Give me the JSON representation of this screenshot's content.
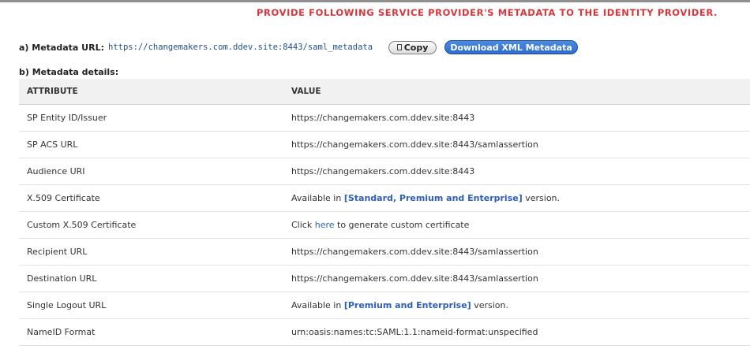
{
  "notice": "PROVIDE FOLLOWING SERVICE PROVIDER'S METADATA TO THE IDENTITY PROVIDER.",
  "metadata_url": {
    "label": "a) Metadata URL:",
    "value": "https://changemakers.com.ddev.site:8443/saml_metadata",
    "copy_label": "Copy",
    "copy_icon": "copy-icon",
    "download_label": "Download XML Metadata"
  },
  "details": {
    "title": "b) Metadata details:",
    "headers": {
      "attribute": "ATTRIBUTE",
      "value": "VALUE"
    },
    "rows": [
      {
        "attribute": "SP Entity ID/Issuer",
        "value": "https://changemakers.com.ddev.site:8443"
      },
      {
        "attribute": "SP ACS URL",
        "value": "https://changemakers.com.ddev.site:8443/samlassertion"
      },
      {
        "attribute": "Audience URI",
        "value": "https://changemakers.com.ddev.site:8443"
      },
      {
        "attribute": "X.509 Certificate",
        "prefix": "Available in ",
        "highlight": "[Standard, Premium and Enterprise]",
        "suffix": " version."
      },
      {
        "attribute": "Custom X.509 Certificate",
        "prefix": "Click ",
        "link": "here",
        "suffix": " to generate custom certificate"
      },
      {
        "attribute": "Recipient URL",
        "value": "https://changemakers.com.ddev.site:8443/samlassertion"
      },
      {
        "attribute": "Destination URL",
        "value": "https://changemakers.com.ddev.site:8443/samlassertion"
      },
      {
        "attribute": "Single Logout URL",
        "prefix": "Available in ",
        "highlight": "[Premium and Enterprise]",
        "suffix": " version."
      },
      {
        "attribute": "NameID Format",
        "value": "urn:oasis:names:tc:SAML:1.1:nameid-format:unspecified"
      }
    ]
  },
  "colors": {
    "notice": "#d7363d",
    "link": "#2b5fb8",
    "download_button": "#2f6ccd"
  }
}
